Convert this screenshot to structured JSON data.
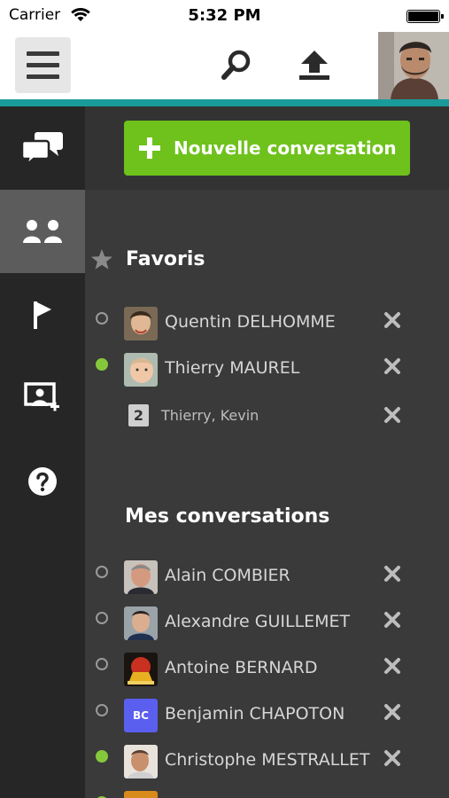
{
  "status_bar": {
    "carrier": "Carrier",
    "time": "5:32 PM"
  },
  "toolbar": {
    "menu_icon": "hamburger-icon",
    "search_icon": "search-icon",
    "upload_icon": "upload-icon"
  },
  "rail": {
    "items": [
      {
        "icon": "conversations-icon",
        "active": false
      },
      {
        "icon": "contacts-icon",
        "active": true
      },
      {
        "icon": "flag-icon",
        "active": false
      },
      {
        "icon": "screen-share-icon",
        "active": false
      },
      {
        "icon": "help-icon",
        "active": false
      }
    ]
  },
  "main": {
    "new_conversation_label": "Nouvelle conversation",
    "favorites": {
      "title": "Favoris",
      "items": [
        {
          "name": "Quentin DELHOMME",
          "online": false
        },
        {
          "name": "Thierry MAUREL",
          "online": true
        }
      ],
      "group": {
        "count": "2",
        "members": "Thierry,  Kevin"
      }
    },
    "conversations": {
      "title": "Mes conversations",
      "items": [
        {
          "name": "Alain COMBIER",
          "online": false
        },
        {
          "name": "Alexandre GUILLEMET",
          "online": false
        },
        {
          "name": "Antoine BERNARD",
          "online": false
        },
        {
          "name": "Benjamin CHAPOTON",
          "online": false,
          "initials": "BC"
        },
        {
          "name": "Christophe MESTRALLET",
          "online": true
        }
      ]
    }
  },
  "colors": {
    "accent_green": "#6ec21b",
    "teal": "#1a9b9b",
    "online": "#86c83b",
    "rail_bg": "#262626",
    "panel_bg": "#3a3a3a"
  }
}
